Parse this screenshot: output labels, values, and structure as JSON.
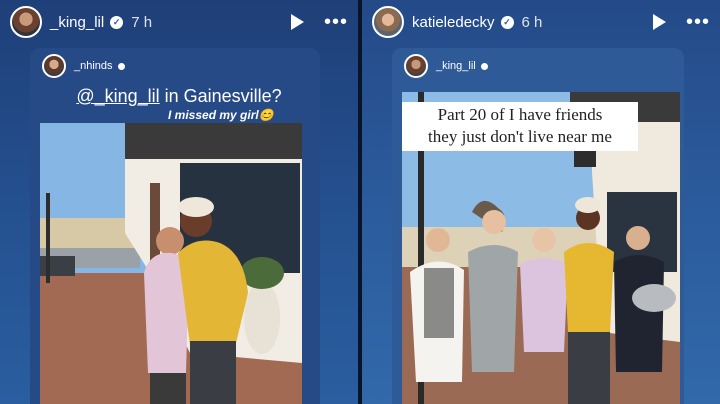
{
  "left_story": {
    "username": "_king_lil",
    "time": "7 h",
    "shared_card": {
      "username": "_nhinds",
      "caption_mention": "@_king_lil",
      "caption_rest": " in Gainesville?",
      "caption_sub": "I missed my girl😊"
    }
  },
  "right_story": {
    "username": "katieledecky",
    "time": "6 h",
    "shared_card": {
      "username": "_king_lil",
      "text_line1": "Part 20 of I have friends",
      "text_line2": "they just don't live near me"
    }
  },
  "icons": {
    "play": "play-icon",
    "more": "more-icon",
    "verified": "verified-badge-icon"
  },
  "colors": {
    "left_bg": "#24508f",
    "right_bg": "#2b5b9c"
  }
}
